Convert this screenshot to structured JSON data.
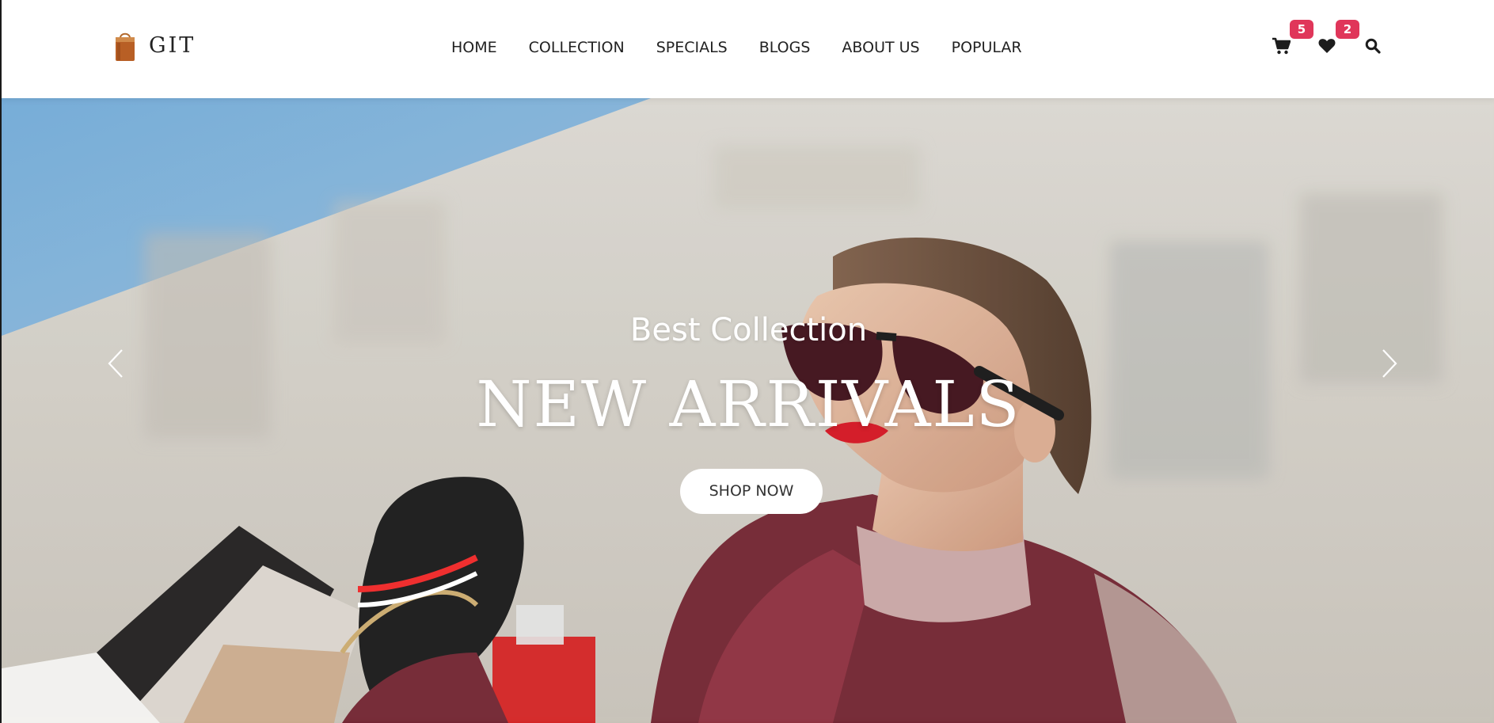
{
  "header": {
    "brand_name": "GIT",
    "logo_icon": "shopping-bag-icon",
    "nav": [
      {
        "label": "HOME"
      },
      {
        "label": "COLLECTION"
      },
      {
        "label": "SPECIALS"
      },
      {
        "label": "BLOGS"
      },
      {
        "label": "ABOUT US"
      },
      {
        "label": "POPULAR"
      }
    ],
    "cart": {
      "icon": "cart-icon",
      "count": "5"
    },
    "wishlist": {
      "icon": "heart-icon",
      "count": "2"
    },
    "search": {
      "icon": "search-icon"
    }
  },
  "hero": {
    "subtitle": "Best Collection",
    "title": "NEW ARRIVALS",
    "cta_label": "SHOP NOW",
    "prev_icon": "chevron-left-icon",
    "next_icon": "chevron-right-icon"
  },
  "colors": {
    "badge": "#e0365a",
    "nav_text": "#222222",
    "hero_text": "#ffffff",
    "button_bg": "#ffffff"
  }
}
